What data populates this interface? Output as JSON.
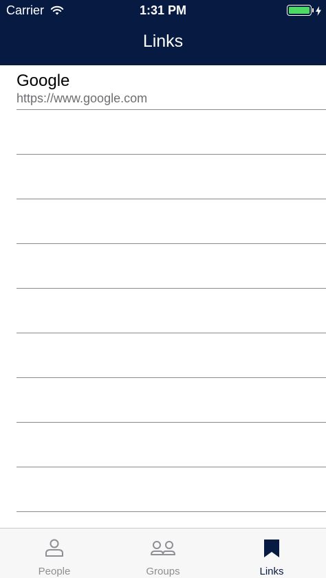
{
  "status_bar": {
    "carrier": "Carrier",
    "time": "1:31 PM",
    "battery_color": "#4cd964"
  },
  "nav": {
    "title": "Links",
    "background_color": "#071a41"
  },
  "links": [
    {
      "title": "Google",
      "url": "https://www.google.com"
    }
  ],
  "tab_bar": {
    "tabs": [
      {
        "label": "People",
        "icon": "person-icon",
        "active": false
      },
      {
        "label": "Groups",
        "icon": "group-icon",
        "active": false
      },
      {
        "label": "Links",
        "icon": "bookmark-icon",
        "active": true
      }
    ],
    "active_color": "#071a41",
    "inactive_color": "#8e8e93"
  }
}
